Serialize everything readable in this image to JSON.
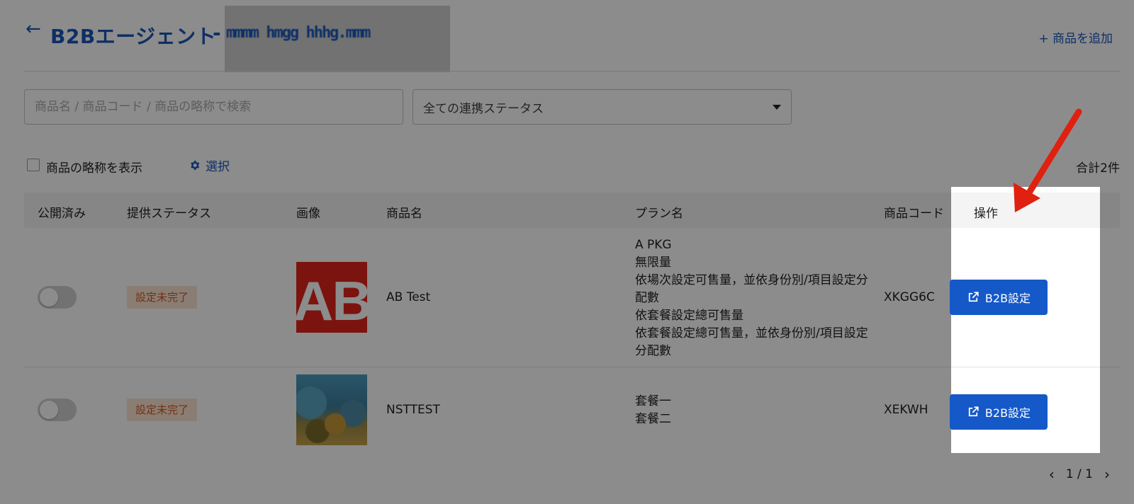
{
  "header": {
    "title": "B2Bエージェント",
    "dash": "-",
    "redacted_account": "mmmm hmgg hhhg.mmm",
    "add_product": "+ 商品を追加"
  },
  "filters": {
    "search_placeholder": "商品名 / 商品コード / 商品の略称で検索",
    "status_select": "全ての連携ステータス"
  },
  "options": {
    "abbrev_label": "商品の略称を表示",
    "select_label": "選択",
    "total": "合計2件"
  },
  "table": {
    "columns": [
      "公開済み",
      "提供ステータス",
      "画像",
      "商品名",
      "プラン名",
      "商品コード",
      "操作"
    ],
    "rows": [
      {
        "published": false,
        "status": "設定未完了",
        "image": "ab-test-logo",
        "name": "AB Test",
        "image_text": "AB",
        "plans": [
          "A PKG",
          "無限量",
          "依場次設定可售量，並依身份別/項目設定分配數",
          "依套餐設定總可售量",
          "依套餐設定總可售量，並依身份別/項目設定分配數"
        ],
        "code": "XKGG6C",
        "action": "B2B設定"
      },
      {
        "published": false,
        "status": "設定未完了",
        "image": "coral-reef-photo",
        "name": "NSTTEST",
        "plans": [
          "套餐一",
          "套餐二"
        ],
        "code": "XEKWH",
        "action": "B2B設定"
      }
    ]
  },
  "pagination": {
    "current": "1 / 1"
  },
  "colors": {
    "accent": "#1a56b8",
    "button": "#1558c8",
    "badge_bg": "#fbe3d3",
    "badge_text": "#d25a1f",
    "annotation_arrow": "#e02010"
  }
}
